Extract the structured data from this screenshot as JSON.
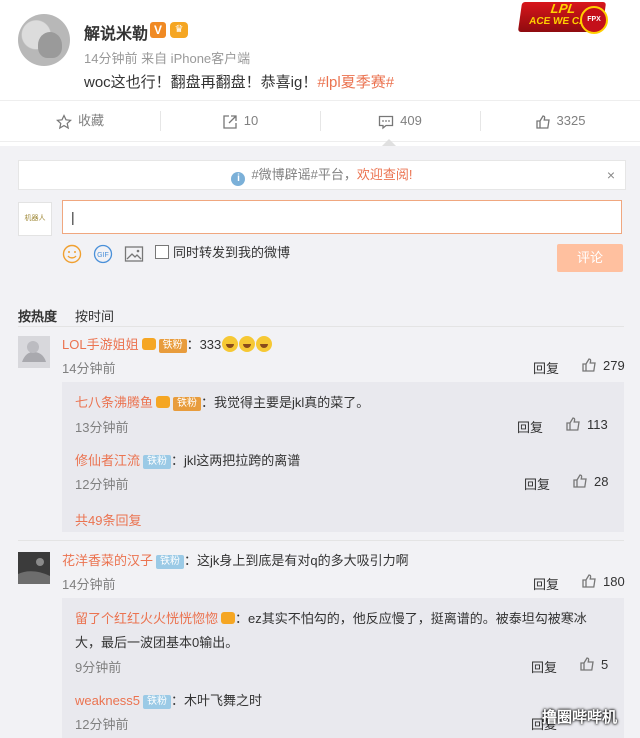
{
  "post": {
    "username": "解说米勒",
    "v_badge": "V",
    "meta": "14分钟前 来自 iPhone客户端",
    "text": "woc这也行！翻盘再翻盘！恭喜ig！",
    "hashtag": "#lpl夏季赛#",
    "logo_top": "LPL",
    "logo_bottom": "ACE WE CAN",
    "logo_badge": "FPX"
  },
  "actions": {
    "favorite": "收藏",
    "repost": "10",
    "comment": "409",
    "like": "3325"
  },
  "notice": {
    "text_plain": "#微博辟谣#平台，",
    "text_link": "欢迎查阅!",
    "close": "×"
  },
  "composer": {
    "avatar_text": "机器人",
    "input_value": "|",
    "repost_label": "同时转发到我的微博",
    "submit_label": "评论"
  },
  "sort": {
    "hot": "按热度",
    "time": "按时间"
  },
  "comments": [
    {
      "name": "LOL手游姐姐",
      "badge": "铁粉",
      "text": "：333",
      "time": "14分钟前",
      "reply": "回复",
      "likes": "279",
      "replies": [
        {
          "name": "七八条沸腾鱼",
          "badge": "铁粉",
          "text": "：我觉得主要是jkl真的菜了。",
          "time": "13分钟前",
          "reply": "回复",
          "likes": "113"
        },
        {
          "name": "修仙者江流",
          "badge": "铁粉",
          "text": "：jkl这两把拉跨的离谱",
          "time": "12分钟前",
          "reply": "回复",
          "likes": "28"
        }
      ],
      "more": "共49条回复"
    },
    {
      "name": "花洋香菜的汉子",
      "badge": "铁粉",
      "text": "：这jk身上到底是有对q的多大吸引力啊",
      "time": "14分钟前",
      "reply": "回复",
      "likes": "180",
      "replies": [
        {
          "name": "留了个红红火火恍恍惚惚",
          "text_line1": "：ez其实不怕勾的，他反应慢了，挺离谱的。被泰坦勾被寒冰",
          "text_line2": "大，最后一波团基本0输出。",
          "time": "9分钟前",
          "reply": "回复",
          "likes": "5"
        },
        {
          "name": "weakness5",
          "badge": "铁粉",
          "text": "：木叶飞舞之时",
          "time": "12分钟前",
          "reply": "回复"
        }
      ]
    }
  ],
  "watermark": "撸圈哔哔机",
  "colors": {
    "accent": "#eb7350",
    "badge_blue": "#9bcae6",
    "submit": "#ffc09f",
    "bg_comments": "#f2f2f5"
  }
}
